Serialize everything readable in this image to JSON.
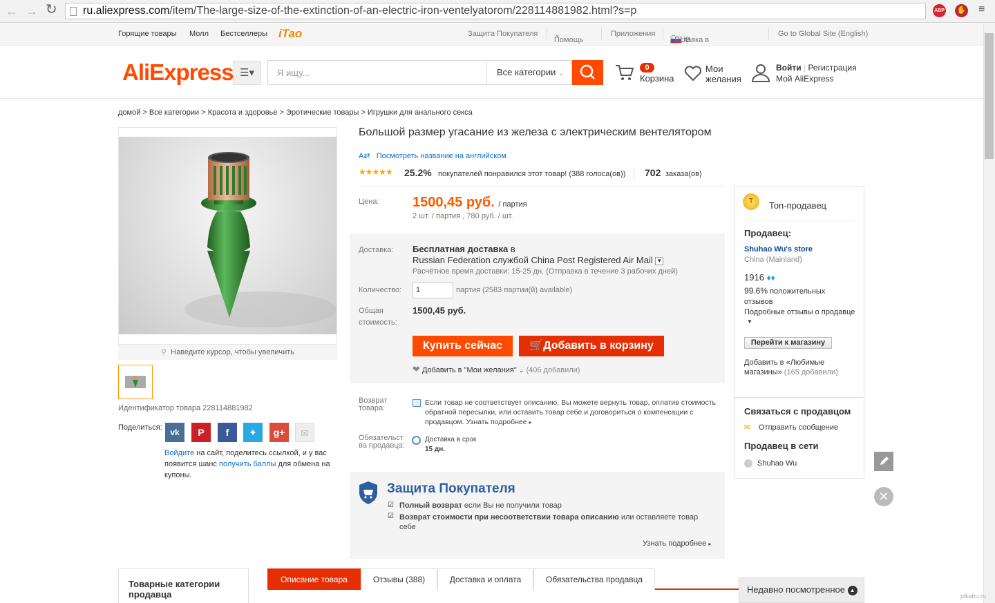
{
  "browser": {
    "url_host": "ru.aliexpress.com",
    "url_path": "/item/The-large-size-of-the-extinction-of-an-electric-iron-ventelyatorom/228114881982.html?s=p",
    "ext_abp": "ABP"
  },
  "topnav": {
    "left": [
      "Горящие товары",
      "Молл",
      "Бестселлеры",
      "iTao"
    ],
    "buyer_protection": "Защита Покупателя",
    "help": "Помощь",
    "apps": "Приложения",
    "delivery": "Доставка в",
    "currency": "/ RUB",
    "global": "Go to Global Site (English)"
  },
  "header": {
    "logo": "AliExpress",
    "search_placeholder": "Я ищу...",
    "all_categories": "Все категории",
    "cart_count": "0",
    "cart_label": "Корзина",
    "wishlist_line1": "Мои",
    "wishlist_line2": "желания",
    "login": "Войти",
    "register": "Регистрация",
    "my_ali": "Мой AliExpress"
  },
  "breadcrumb": "домой > Все категории > Красота и здоровье > Эротические товары > Игрушки для анального секса",
  "product": {
    "title": "Большой размер угасание из железа с электрическим вентелятором",
    "translate_link": "Посмотреть название на английском",
    "rating_percent": "25.2%",
    "rating_text": "покупателей понравился этот товар! (388 голоса(ов))",
    "orders_count": "702",
    "orders_label": "заказа(ов)",
    "zoom_hint": "Наведите курсор, чтобы увеличить",
    "product_id": "Идентификатор товара 228114881982"
  },
  "share": {
    "label": "Поделиться:",
    "info_link_login": "Войдите",
    "info_text1": " на сайт, поделитесь ссылкой, и у вас появится шанс ",
    "info_link_points": "получить баллы",
    "info_text2": " для обмена на купоны."
  },
  "pricing": {
    "price_label": "Цена:",
    "price": "1500,45 руб.",
    "price_unit": "/ партия",
    "price_sub": "2 шт. / партия , 780 руб. / шт.",
    "delivery_label": "Доставка:",
    "free_delivery": "Бесплатная доставка",
    "free_delivery_in": "в",
    "delivery_service": "Russian Federation службой China Post Registered Air Mail",
    "delivery_time": "Расчётное время доставки: 15-25 дн. (Отправка в течение 3 рабочих дней)",
    "qty_label": "Количество:",
    "qty_value": "1",
    "qty_available": "партия (2583 партии(й) available)",
    "total_label1": "Общая",
    "total_label2": "стоимость:",
    "total": "1500,45 руб.",
    "buy_now": "Купить сейчас",
    "add_to_cart": "Добавить в корзину",
    "wishlist_add": "Добавить в \"Мои желания\"",
    "wishlist_count": "(406 добавили)"
  },
  "returns": {
    "label1": "Возврат",
    "label2": "товара:",
    "text": "Если товар не соответствует описанию, Вы можете вернуть товар, оплатив стоимость обратной пересылки, или оставить товар себе и договориться о компенсации с продавцом. Узнать подробнее",
    "commit_label1": "Обязательст",
    "commit_label2": "ва продавца:",
    "commit_text": "Доставка в срок",
    "commit_days": "15 дн."
  },
  "protection": {
    "title": "Защита Покупателя",
    "item1_bold": "Полный возврат",
    "item1_rest": " если Вы не получили товар",
    "item2_bold": "Возврат стоимости при несоответствии товара описанию",
    "item2_rest": " или оставляете товар себе",
    "more": "Узнать подробнее"
  },
  "seller": {
    "top_label": "Топ-продавец",
    "seller_label": "Продавец:",
    "store_name": "Shuhao Wu's store",
    "country": "China (Mainland)",
    "score": "1916",
    "positive_pct": "99.6%",
    "positive_text1": "положительных",
    "positive_text2": "отзывов",
    "detailed": "Подробные отзывы о продавце",
    "go_store": "Перейти к магазину",
    "fav_text1": "Добавить в «Любимые",
    "fav_text2": "магазины»",
    "fav_count": "(165 добавили)",
    "contact_title": "Связаться с продавцом",
    "send_message": "Отправить сообщение",
    "online_title": "Продавец в сети",
    "online_name": "Shuhao Wu"
  },
  "bottom": {
    "categories_title1": "Товарные категории",
    "categories_title2": "продавца",
    "tabs": [
      "Описание товара",
      "Отзывы (388)",
      "Доставка и оплата",
      "Обязательства продавца"
    ],
    "recently_viewed": "Недавно посмотренное",
    "watermark": "pikabu.ru"
  },
  "colors": {
    "accent": "#ff4a00",
    "accent_dark": "#e62e04",
    "link": "#0a6ccf",
    "product_green": "#2e8b2e",
    "product_copper": "#d8946a"
  }
}
